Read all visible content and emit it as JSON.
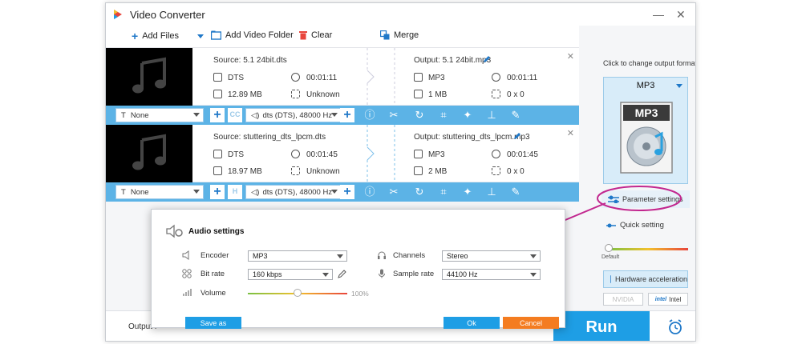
{
  "window": {
    "title": "Video Converter",
    "min": "—",
    "close": "✕"
  },
  "toolbar": {
    "add_files": "Add Files",
    "add_video_folder": "Add Video Folder",
    "clear": "Clear",
    "merge": "Merge"
  },
  "files": [
    {
      "source": "Source: 5.1 24bit.dts",
      "src_format": "DTS",
      "src_duration": "00:01:11",
      "src_size": "12.89 MB",
      "src_resolution": "Unknown",
      "output": "Output: 5.1 24bit.mp3",
      "out_format": "MP3",
      "out_duration": "00:01:11",
      "out_size": "1 MB",
      "out_resolution": "0 x 0",
      "subtitle": "None",
      "audio_track": "dts (DTS), 48000 Hz"
    },
    {
      "source": "Source: stuttering_dts_lpcm.dts",
      "src_format": "DTS",
      "src_duration": "00:01:45",
      "src_size": "18.97 MB",
      "src_resolution": "Unknown",
      "output": "Output: stuttering_dts_lpcm.mp3",
      "out_format": "MP3",
      "out_duration": "00:01:45",
      "out_size": "2 MB",
      "out_resolution": "0 x 0",
      "subtitle": "None",
      "audio_track": "dts (DTS), 48000 Hz"
    }
  ],
  "right_panel": {
    "change_format": "Click to change output format:",
    "format": "MP3",
    "format_badge": "MP3",
    "parameter_settings": "Parameter settings",
    "quick_setting": "Quick setting",
    "default": "Default",
    "hardware_acceleration": "Hardware acceleration",
    "nvidia": "NVIDIA",
    "intel": "Intel",
    "intel_logo": "intel"
  },
  "bottom": {
    "output_label": "Output f",
    "run": "Run"
  },
  "dialog": {
    "title": "Audio settings",
    "encoder_label": "Encoder",
    "encoder": "MP3",
    "bitrate_label": "Bit rate",
    "bitrate": "160 kbps",
    "volume_label": "Volume",
    "volume": "100%",
    "channels_label": "Channels",
    "channels": "Stereo",
    "sample_rate_label": "Sample rate",
    "sample_rate": "44100 Hz",
    "save_as": "Save as",
    "ok": "Ok",
    "cancel": "Cancel",
    "volume_level": 0.5
  },
  "colors": {
    "accent": "#1e9ee5",
    "editbar": "#5cb3e6",
    "cancel": "#f47c20",
    "annotation": "#c2278f"
  }
}
